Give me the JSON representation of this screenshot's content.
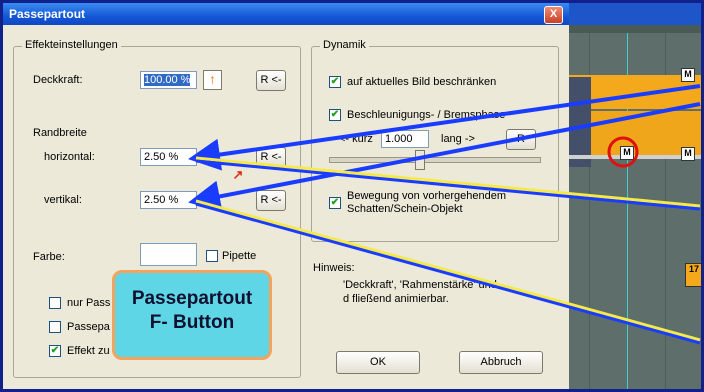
{
  "window": {
    "title": "Passepartout",
    "close_symbol": "X"
  },
  "effekt": {
    "group_title": "Effekteinstellungen",
    "deckkraft_label": "Deckkraft:",
    "deckkraft_value": "100.00 %",
    "reset_label": "R <-",
    "randbreite_label": "Randbreite",
    "horizontal_label": "horizontal:",
    "horizontal_value": "2.50 %",
    "vertikal_label": "vertikal:",
    "vertikal_value": "2.50 %",
    "farbe_label": "Farbe:",
    "pipette_label": "Pipette",
    "opt1_label": "nur Pass",
    "opt2_label": "Passepa",
    "opt3_label": "Effekt zu"
  },
  "dynamik": {
    "group_title": "Dynamik",
    "check1_label": "auf aktuelles Bild beschränken",
    "check2_label": "Beschleunigungs- / Bremsphase",
    "kurz_label": "<- kurz",
    "kurz_value": "1.000",
    "lang_label": "lang ->",
    "reset_label": "R",
    "check3_label_line1": "Bewegung von vorhergehendem",
    "check3_label_line2": "Schatten/Schein-Objekt"
  },
  "hinweis": {
    "title": "Hinweis:",
    "line1": "'Deckkraft', 'Rahmenstärke' und",
    "line2": "d fließend animierbar."
  },
  "buttons": {
    "ok": "OK",
    "abbruch": "Abbruch"
  },
  "callout": {
    "line1": "Passepartout",
    "line2": "F- Button"
  },
  "timeline": {
    "marker_labels": [
      "M",
      "M",
      "M",
      "17"
    ]
  },
  "colors": {
    "accent": "#f4a91c",
    "callout_bg": "#5fd6e6",
    "callout_border": "#f4a35c",
    "arrow_blue": "#1a3cff",
    "arrow_yellow": "#f5ea4a",
    "highlight_red": "#e01010"
  }
}
